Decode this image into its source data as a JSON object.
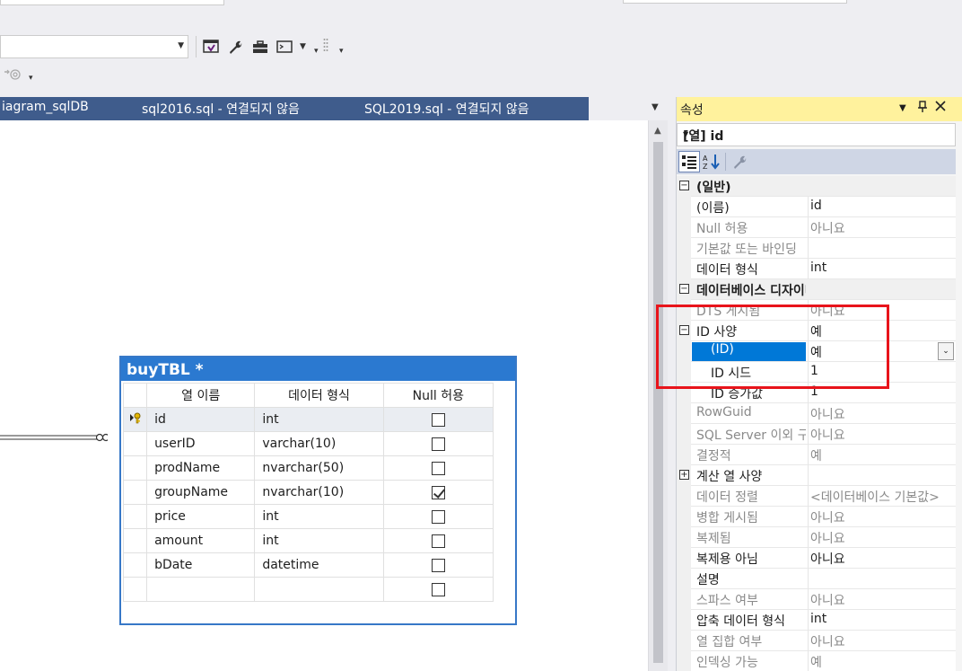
{
  "tabs": [
    {
      "label": "iagram_sqlDB"
    },
    {
      "label": "sql2016.sql - 연결되지 않음"
    },
    {
      "label": "SQL2019.sql - 연결되지 않음"
    }
  ],
  "table": {
    "title": "buyTBL *",
    "headers": [
      "열 이름",
      "데이터 형식",
      "Null 허용"
    ],
    "rows": [
      {
        "name": "id",
        "type": "int",
        "null": false,
        "key": true
      },
      {
        "name": "userID",
        "type": "varchar(10)",
        "null": false
      },
      {
        "name": "prodName",
        "type": "nvarchar(50)",
        "null": false
      },
      {
        "name": "groupName",
        "type": "nvarchar(10)",
        "null": true
      },
      {
        "name": "price",
        "type": "int",
        "null": false
      },
      {
        "name": "amount",
        "type": "int",
        "null": false
      },
      {
        "name": "bDate",
        "type": "datetime",
        "null": false
      },
      {
        "name": "",
        "type": "",
        "null": false
      }
    ]
  },
  "props": {
    "title": "속성",
    "object": "[열] id",
    "rows": [
      {
        "kind": "cat",
        "exp": "⊟",
        "name": "(일반)"
      },
      {
        "name": "(이름)",
        "val": "id"
      },
      {
        "name": "Null 허용",
        "val": "아니요",
        "dim": true
      },
      {
        "name": "기본값 또는 바인딩",
        "val": "",
        "dim": true
      },
      {
        "name": "데이터 형식",
        "val": "int"
      },
      {
        "kind": "cat",
        "exp": "⊟",
        "name": "데이터베이스 디자이너"
      },
      {
        "name": "DTS 게시됨",
        "val": "아니요",
        "dim": true
      },
      {
        "name": "ID 사양",
        "val": "예",
        "exp": "⊟",
        "expname": true
      },
      {
        "name": "(ID)",
        "val": "예",
        "child": true,
        "selected": true
      },
      {
        "name": "ID 시드",
        "val": "1",
        "child": true
      },
      {
        "name": "ID 증가값",
        "val": "1",
        "child": true
      },
      {
        "name": "RowGuid",
        "val": "아니요",
        "dim": true
      },
      {
        "name": "SQL Server 이외 구독자",
        "val": "아니요",
        "dim": true
      },
      {
        "name": "결정적",
        "val": "예",
        "dim": true
      },
      {
        "name": "계산 열 사양",
        "val": "",
        "exp": "⊞",
        "expname": true
      },
      {
        "name": "데이터 정렬",
        "val": "<데이터베이스 기본값>",
        "dim": true
      },
      {
        "name": "병합 게시됨",
        "val": "아니요",
        "dim": true
      },
      {
        "name": "복제됨",
        "val": "아니요",
        "dim": true
      },
      {
        "name": "복제용 아님",
        "val": "아니요"
      },
      {
        "name": "설명",
        "val": ""
      },
      {
        "name": "스파스 여부",
        "val": "아니요",
        "dim": true
      },
      {
        "name": "압축 데이터 형식",
        "val": "int"
      },
      {
        "name": "열 집합 여부",
        "val": "아니요",
        "dim": true
      },
      {
        "name": "인덱싱 가능",
        "val": "예",
        "dim": true
      }
    ]
  }
}
